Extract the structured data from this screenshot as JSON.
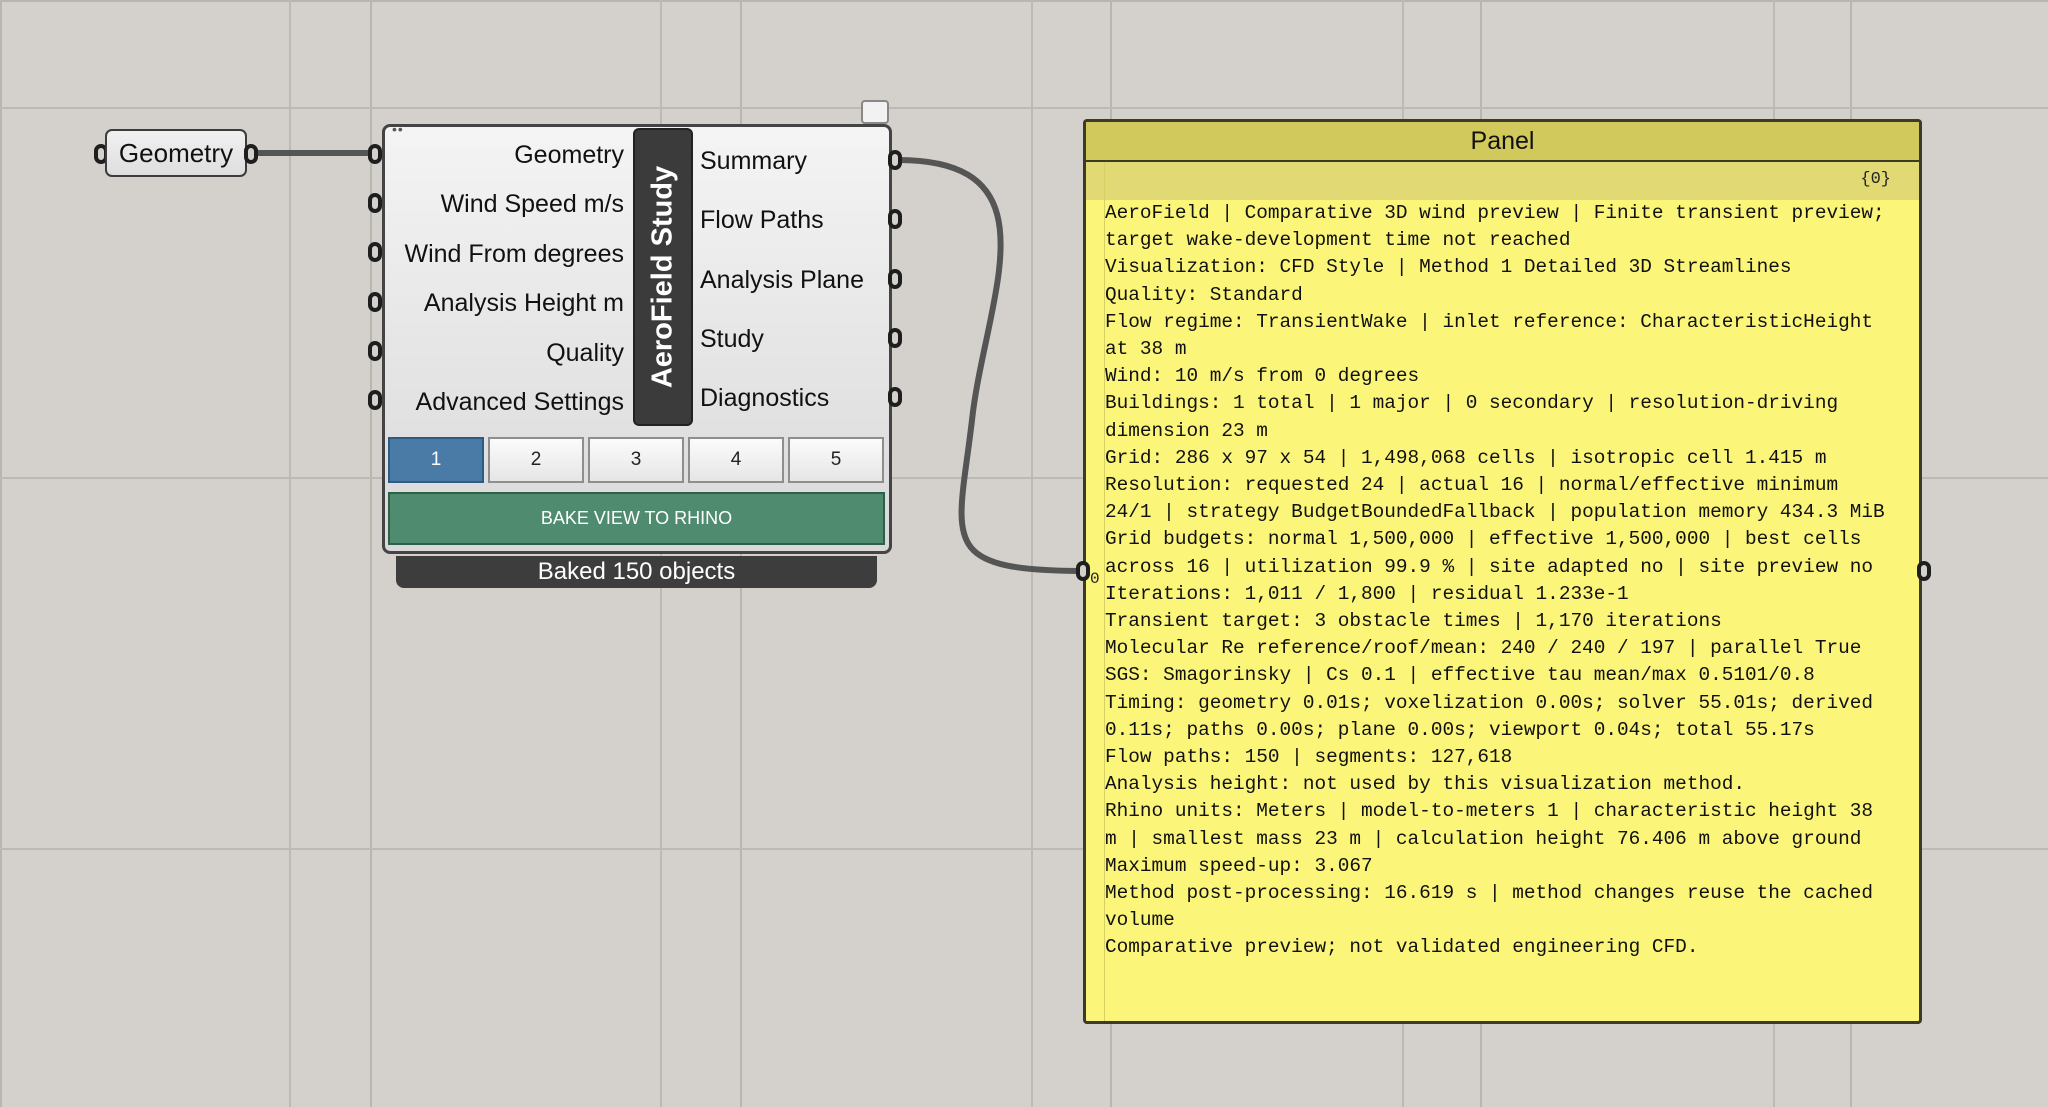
{
  "param": {
    "label": "Geometry"
  },
  "component": {
    "title": "AeroField Study",
    "inputs": [
      "Geometry",
      "Wind Speed m/s",
      "Wind From degrees",
      "Analysis Height m",
      "Quality",
      "Advanced Settings"
    ],
    "outputs": [
      "Summary",
      "Flow Paths",
      "Analysis Plane",
      "Study",
      "Diagnostics"
    ],
    "tabs": [
      "1",
      "2",
      "3",
      "4",
      "5"
    ],
    "active_tab": "1",
    "bake_label": "BAKE VIEW TO RHINO",
    "status": "Baked 150 objects"
  },
  "panel": {
    "title": "Panel",
    "path": "{0}",
    "index": "0",
    "lines": [
      "AeroField | Comparative 3D wind preview | Finite transient preview;",
      "target wake-development time not reached",
      "Visualization: CFD Style | Method 1 Detailed 3D Streamlines",
      "Quality: Standard",
      "Flow regime: TransientWake | inlet reference: CharacteristicHeight",
      "at 38 m",
      "Wind: 10 m/s from 0 degrees",
      "Buildings: 1 total | 1 major | 0 secondary | resolution-driving",
      "dimension 23 m",
      "Grid: 286 x 97 x 54 | 1,498,068 cells | isotropic cell 1.415 m",
      "Resolution: requested 24 | actual 16 | normal/effective minimum",
      "24/1 | strategy BudgetBoundedFallback | population memory 434.3 MiB",
      "Grid budgets: normal 1,500,000 | effective 1,500,000 | best cells",
      "across 16 | utilization 99.9 % | site adapted no | site preview no",
      "Iterations: 1,011 / 1,800 | residual 1.233e-1",
      "Transient target: 3 obstacle times | 1,170 iterations",
      "Molecular Re reference/roof/mean: 240 / 240 / 197 | parallel True",
      "SGS: Smagorinsky | Cs 0.1 | effective tau mean/max 0.5101/0.8",
      "Timing: geometry 0.01s; voxelization 0.00s; solver 55.01s; derived",
      "0.11s; paths 0.00s; plane 0.00s; viewport 0.04s; total 55.17s",
      "Flow paths: 150 | segments: 127,618",
      "Analysis height: not used by this visualization method.",
      "Rhino units: Meters | model-to-meters 1 | characteristic height 38",
      "m | smallest mass 23 m | calculation height 76.406 m above ground",
      "Maximum speed-up: 3.067",
      "Method post-processing: 16.619 s | method changes reuse the cached",
      "volume",
      "Comparative preview; not validated engineering CFD."
    ]
  },
  "colors": {
    "canvas": "#d4d1cc",
    "panel_bg": "#fbf57a",
    "panel_header": "#d2c95c",
    "tab_active": "#4a7ba7",
    "bake_button": "#4f8b6e",
    "wire": "#555555"
  }
}
